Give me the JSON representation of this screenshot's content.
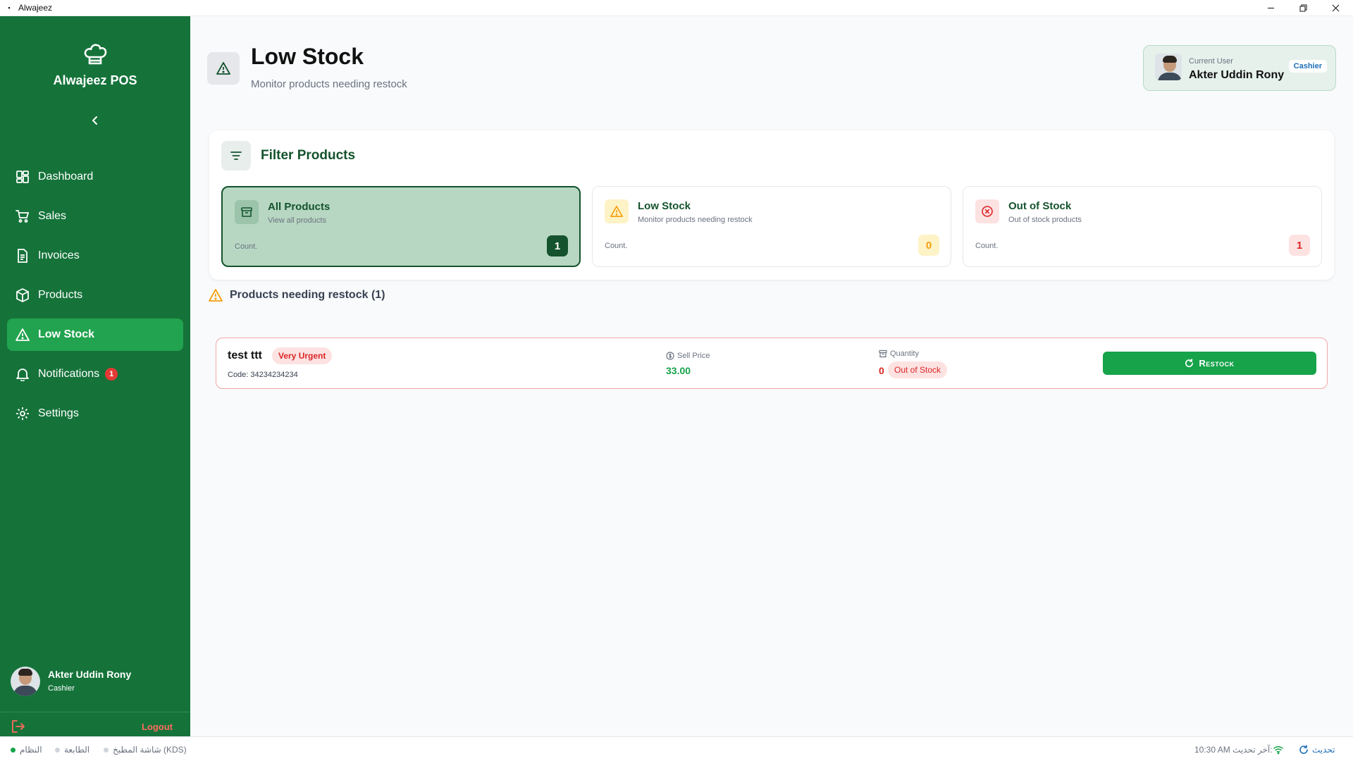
{
  "window": {
    "title": "Alwajeez"
  },
  "sidebar": {
    "brand": "Alwajeez POS",
    "items": [
      {
        "label": "Dashboard",
        "icon": "dashboard-icon"
      },
      {
        "label": "Sales",
        "icon": "cart-icon"
      },
      {
        "label": "Invoices",
        "icon": "invoice-icon"
      },
      {
        "label": "Products",
        "icon": "box-icon"
      },
      {
        "label": "Low Stock",
        "icon": "warning-icon",
        "active": true
      },
      {
        "label": "Notifications",
        "icon": "bell-icon",
        "badge": "1"
      },
      {
        "label": "Settings",
        "icon": "gear-icon"
      }
    ],
    "user": {
      "name": "Akter Uddin Rony",
      "role": "Cashier"
    },
    "logout_label": "Logout"
  },
  "header": {
    "title": "Low Stock",
    "subtitle": "Monitor products needing restock",
    "current_user": {
      "label": "Current User",
      "name": "Akter Uddin Rony",
      "role": "Cashier"
    }
  },
  "filter": {
    "title": "Filter Products",
    "cards": [
      {
        "title": "All Products",
        "subtitle": "View all products",
        "count_label": "Count.",
        "count": "1",
        "active": true
      },
      {
        "title": "Low Stock",
        "subtitle": "Monitor products needing restock",
        "count_label": "Count.",
        "count": "0"
      },
      {
        "title": "Out of Stock",
        "subtitle": "Out of stock products",
        "count_label": "Count.",
        "count": "1"
      }
    ]
  },
  "section": {
    "title": "Products needing restock (1)"
  },
  "products": [
    {
      "name": "test ttt",
      "urgency": "Very Urgent",
      "code": "Code: 34234234234",
      "price_label": "Sell Price",
      "price": "33.00",
      "qty_label": "Quantity",
      "qty": "0",
      "stock_status": "Out of Stock",
      "action": "Restock"
    }
  ],
  "statusbar": {
    "system": "النظام",
    "printer": "الطابعة",
    "kds": "شاشة المطبخ (KDS)",
    "last_update": "10:30 AM آخر تحديث:",
    "refresh": "تحديث"
  },
  "colors": {
    "sidebar": "#15733a",
    "active_nav": "#22a34f",
    "accent_dark": "#14532d",
    "danger": "#dc2626",
    "success": "#16a34a",
    "warning": "#f59e0b"
  }
}
